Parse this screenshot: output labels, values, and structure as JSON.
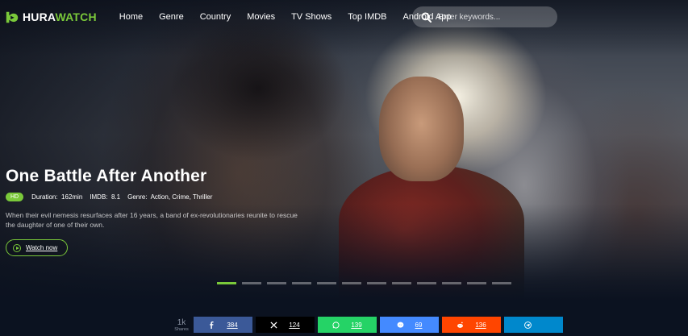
{
  "brand": {
    "name_part1": "HURA",
    "name_part2": "WATCH",
    "accent": "#7ac93a"
  },
  "nav": {
    "items": [
      "Home",
      "Genre",
      "Country",
      "Movies",
      "TV Shows",
      "Top IMDB",
      "Android App"
    ]
  },
  "search": {
    "placeholder": "Enter keywords...",
    "value": ""
  },
  "hero": {
    "title": "One Battle After Another",
    "quality": "HD",
    "duration_label": "Duration:",
    "duration": "162min",
    "imdb_label": "IMDB:",
    "imdb": "8.1",
    "genre_label": "Genre:",
    "genre": "Action, Crime, Thriller",
    "description": "When their evil nemesis resurfaces after 16 years, a band of ex-revolutionaries reunite to rescue the daughter of one of their own.",
    "watch_label": "Watch now"
  },
  "slider": {
    "total": 12,
    "active_index": 0
  },
  "share": {
    "total": "1k",
    "total_label": "Shares",
    "buttons": [
      {
        "network": "facebook",
        "icon": "facebook-icon",
        "count": "384",
        "color": "#3b5998"
      },
      {
        "network": "x",
        "icon": "x-icon",
        "count": "124",
        "color": "#000000"
      },
      {
        "network": "whatsapp",
        "icon": "whatsapp-icon",
        "count": "139",
        "color": "#25d366"
      },
      {
        "network": "messenger",
        "icon": "messenger-icon",
        "count": "69",
        "color": "#448aff"
      },
      {
        "network": "reddit",
        "icon": "reddit-icon",
        "count": "136",
        "color": "#ff4500"
      },
      {
        "network": "telegram",
        "icon": "telegram-icon",
        "count": "",
        "color": "#0088cc"
      }
    ]
  }
}
